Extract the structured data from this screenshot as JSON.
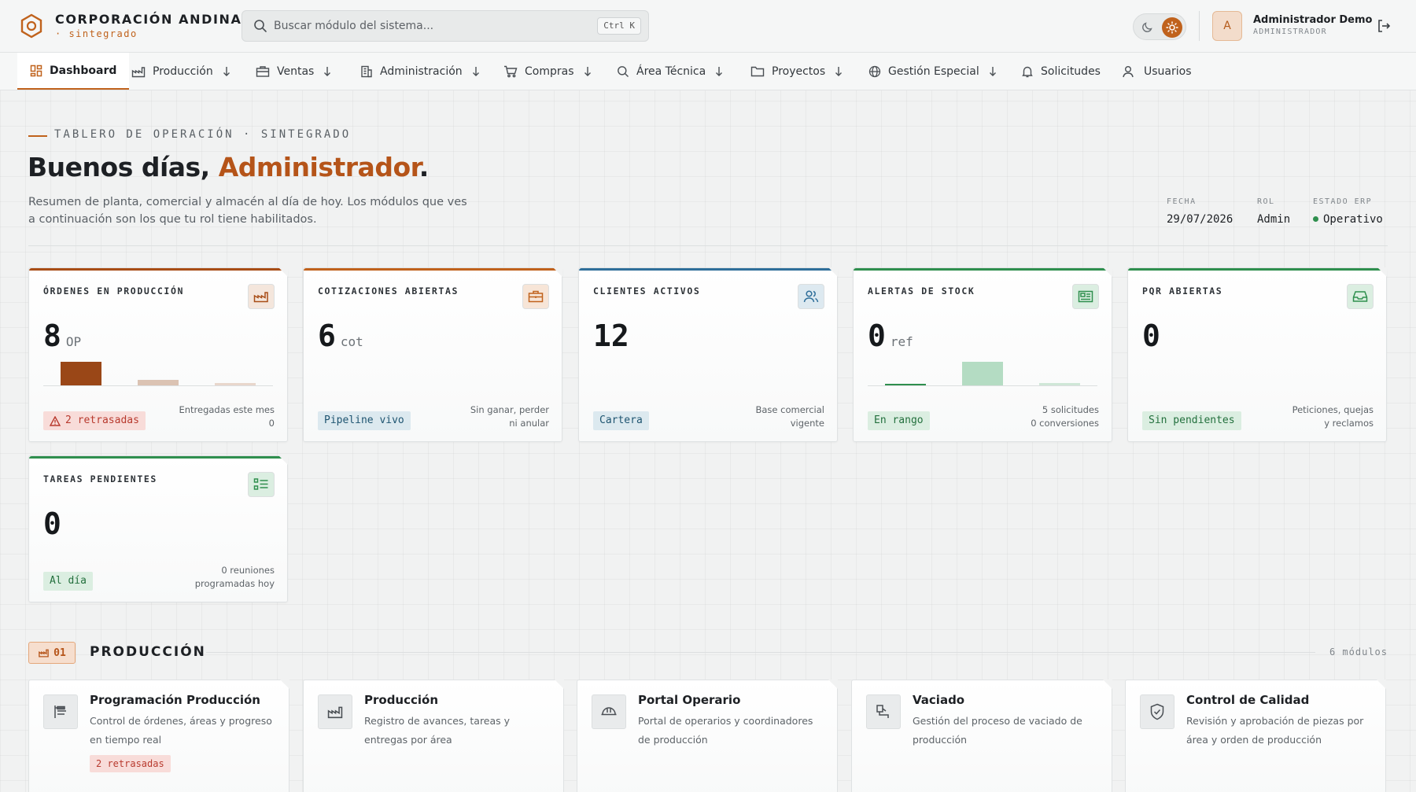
{
  "brand": {
    "name": "CORPORACIÓN ANDINA",
    "subtitle": "· sintegrado"
  },
  "search": {
    "placeholder": "Buscar módulo del sistema...",
    "shortcut": "Ctrl K"
  },
  "user": {
    "avatar_initial": "A",
    "name": "Administrador Demo",
    "role": "ADMINISTRADOR"
  },
  "theme": {
    "accent": "#c0621c"
  },
  "nav": {
    "items": [
      {
        "label": "Dashboard",
        "icon": "dashboard-icon",
        "active": true
      },
      {
        "label": "Producción",
        "icon": "factory-icon",
        "dropdown": true
      },
      {
        "label": "Ventas",
        "icon": "briefcase-icon",
        "dropdown": true
      },
      {
        "label": "Administración",
        "icon": "building-icon",
        "dropdown": true
      },
      {
        "label": "Compras",
        "icon": "cart-icon",
        "dropdown": true
      },
      {
        "label": "Área Técnica",
        "icon": "search-icon",
        "dropdown": true
      },
      {
        "label": "Proyectos",
        "icon": "folder-icon",
        "dropdown": true
      },
      {
        "label": "Gestión Especial",
        "icon": "globe-icon",
        "dropdown": true
      },
      {
        "label": "Solicitudes",
        "icon": "bell-icon"
      },
      {
        "label": "Usuarios",
        "icon": "user-icon"
      }
    ]
  },
  "hero": {
    "eyebrow": "TABLERO DE OPERACIÓN · SINTEGRADO",
    "greeting": "Buenos días,",
    "name": "Administrador",
    "punct": ".",
    "intro": "Resumen de planta, comercial y almacén al día de hoy. Los módulos que ves a continuación son los que tu rol tiene habilitados.",
    "meta": [
      {
        "label": "FECHA",
        "value": "29/07/2026"
      },
      {
        "label": "ROL",
        "value": "Admin"
      },
      {
        "label": "ESTADO ERP",
        "value": "Operativo",
        "status_color": "#2f8f4e"
      }
    ]
  },
  "stats": [
    {
      "title": "ÓRDENES EN PRODUCCIÓN",
      "value": "8",
      "unit": "OP",
      "icon": "factory-icon",
      "color": "#a84d16",
      "spark": [
        0.9,
        0.22,
        0.08
      ],
      "spark_colors": [
        "#9a4717",
        "#dbc3b3",
        "#e8d7cc"
      ],
      "badge": "2 retrasadas",
      "badge_style": "danger",
      "badge_icon": "warning-icon",
      "note": [
        "Entregadas este mes",
        "0"
      ]
    },
    {
      "title": "COTIZACIONES ABIERTAS",
      "value": "6",
      "unit": "cot",
      "icon": "briefcase-icon",
      "color": "#c0621c",
      "badge": "Pipeline vivo",
      "badge_style": "info",
      "note": [
        "Sin ganar, perder",
        "ni anular"
      ]
    },
    {
      "title": "CLIENTES ACTIVOS",
      "value": "12",
      "unit": "",
      "icon": "users-icon",
      "color": "#2f6f9a",
      "badge": "Cartera",
      "badge_style": "info",
      "note": [
        "Base comercial",
        "vigente"
      ]
    },
    {
      "title": "ALERTAS DE STOCK",
      "value": "0",
      "unit": "ref",
      "icon": "inventory-icon",
      "color": "#2f8f4e",
      "spark": [
        0.06,
        0.9,
        0.08
      ],
      "spark_colors": [
        "#2f8f4e",
        "#b4dcc3",
        "#cfe7d7"
      ],
      "badge": "En rango",
      "badge_style": "success",
      "note": [
        "5 solicitudes",
        "0 conversiones"
      ]
    },
    {
      "title": "PQR ABIERTAS",
      "value": "0",
      "unit": "",
      "icon": "inbox-icon",
      "color": "#2f8f4e",
      "badge": "Sin pendientes",
      "badge_style": "success",
      "note": [
        "Peticiones, quejas",
        "y reclamos"
      ]
    },
    {
      "title": "TAREAS PENDIENTES",
      "value": "0",
      "unit": "",
      "icon": "tasks-icon",
      "color": "#2f8f4e",
      "badge": "Al día",
      "badge_style": "success",
      "note": [
        "0 reuniones",
        "programadas hoy"
      ]
    }
  ],
  "section": {
    "number": "01",
    "title": "PRODUCCIÓN",
    "count": "6 módulos"
  },
  "modules": [
    {
      "name": "Programación Producción",
      "desc": "Control de órdenes, áreas y progreso en tiempo real",
      "icon": "schedule-icon",
      "badge": "2 retrasadas"
    },
    {
      "name": "Producción",
      "desc": "Registro de avances, tareas y entregas por área",
      "icon": "factory-icon"
    },
    {
      "name": "Portal Operario",
      "desc": "Portal de operarios y coordinadores de producción",
      "icon": "hardhat-icon"
    },
    {
      "name": "Vaciado",
      "desc": "Gestión del proceso de vaciado de producción",
      "icon": "pour-icon"
    },
    {
      "name": "Control de Calidad",
      "desc": "Revisión y aprobación de piezas por área y orden de producción",
      "icon": "shield-check-icon"
    }
  ]
}
